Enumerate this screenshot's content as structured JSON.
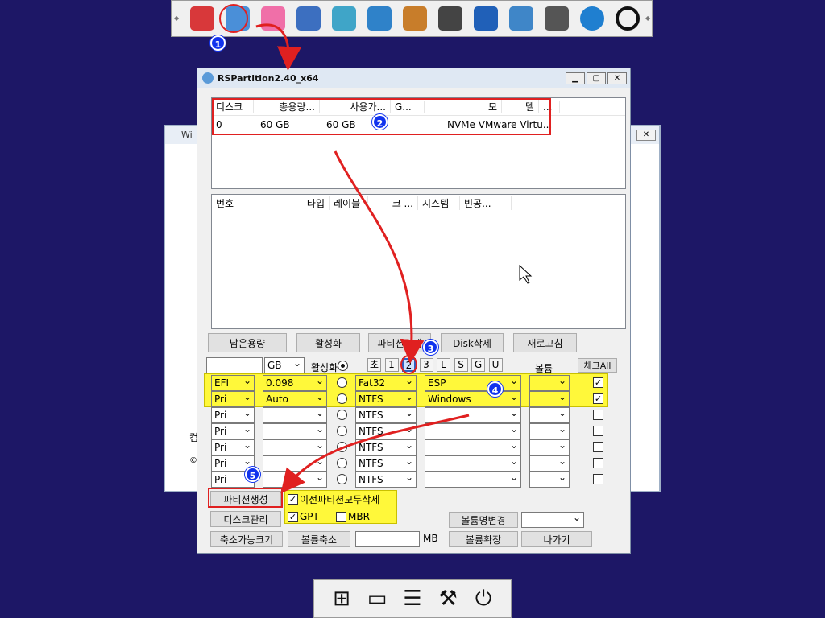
{
  "launcher": {
    "icons": [
      {
        "name": "disk-tool-icon",
        "color": "#d8383a"
      },
      {
        "name": "rspartition-icon",
        "color": "#4a8fd8"
      },
      {
        "name": "windows-tiles-icon",
        "color": "#f06fa8"
      },
      {
        "name": "network-icon",
        "color": "#3c6fc0"
      },
      {
        "name": "document-icon",
        "color": "#3fa5c8"
      },
      {
        "name": "feather-icon",
        "color": "#2f82c9"
      },
      {
        "name": "tools-icon",
        "color": "#c87d2a"
      },
      {
        "name": "drive-icon",
        "color": "#444444"
      },
      {
        "name": "a-app-icon",
        "color": "#2060b8"
      },
      {
        "name": "computer-icon",
        "color": "#3f86c8"
      },
      {
        "name": "snapshot-icon",
        "color": "#555555"
      },
      {
        "name": "sync-icon",
        "color": "#1f7fd0"
      },
      {
        "name": "restart-icon",
        "color": "#111111"
      }
    ]
  },
  "bgwindow": {
    "title": "Wi",
    "side_text_1": "컴",
    "side_text_2": "©"
  },
  "window": {
    "title": "RSPartition2.40_x64",
    "disk_list": {
      "headers": [
        "디스크",
        "총용량...",
        "사용가...",
        "G...",
        "모",
        "델",
        "..."
      ],
      "rows": [
        [
          "0",
          "60 GB",
          "60 GB",
          "",
          "NVMe VMware Virtu..."
        ]
      ]
    },
    "partition_list": {
      "headers": [
        "번호",
        "",
        "",
        "타입",
        "레이블",
        "크 ...",
        "시스템",
        "빈공..."
      ]
    },
    "buttons": {
      "remaining": "남은용량",
      "activate": "활성화",
      "delete_partition": "파티션삭제",
      "delete_disk": "Disk삭제",
      "refresh": "새로고침",
      "create_partition": "파티션생성",
      "disk_management": "디스크관리",
      "shrinkable_size": "축소가능크기",
      "shrink_volume": "볼륨축소",
      "extend_volume": "볼륨확장",
      "exit": "나가기",
      "rename_volume": "볼륨명변경"
    },
    "controls": {
      "unit": "GB",
      "activate_label": "활성화",
      "mode_buttons": [
        "초",
        "1",
        "2",
        "3",
        "L",
        "S",
        "G",
        "U"
      ],
      "volume_label": "볼륨",
      "check_all": "체크All",
      "delete_previous": "이전파티션모두삭제",
      "gpt": "GPT",
      "mbr": "MBR",
      "mb_label": "MB"
    },
    "partitions": [
      {
        "type": "EFI",
        "size": "0.098",
        "fs": "Fat32",
        "label": "ESP",
        "checked": true,
        "active": false
      },
      {
        "type": "Pri",
        "size": "Auto",
        "fs": "NTFS",
        "label": "Windows",
        "checked": true,
        "active": false
      },
      {
        "type": "Pri",
        "size": "",
        "fs": "NTFS",
        "label": "",
        "checked": false,
        "active": false
      },
      {
        "type": "Pri",
        "size": "",
        "fs": "NTFS",
        "label": "",
        "checked": false,
        "active": false
      },
      {
        "type": "Pri",
        "size": "",
        "fs": "NTFS",
        "label": "",
        "checked": false,
        "active": false
      },
      {
        "type": "Pri",
        "size": "",
        "fs": "NTFS",
        "label": "",
        "checked": false,
        "active": false
      },
      {
        "type": "Pri",
        "size": "",
        "fs": "NTFS",
        "label": "",
        "checked": false,
        "active": false
      }
    ]
  },
  "annotations": {
    "badges": [
      "1",
      "2",
      "3",
      "4",
      "5"
    ],
    "highlight_color": "#fff83a",
    "arrow_color": "#e02020"
  }
}
